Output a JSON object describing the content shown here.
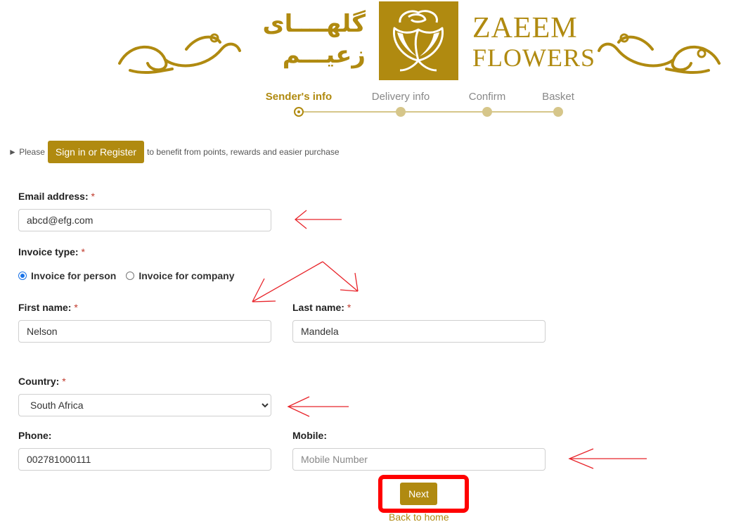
{
  "brand": {
    "name_line1": "ZAEEM",
    "name_line2": "FLOWERS",
    "arabic_line1": "گلهــــای",
    "arabic_line2": "زعیـــم",
    "color": "#b08a10"
  },
  "steps": [
    {
      "label": "Sender's info",
      "active": true
    },
    {
      "label": "Delivery info",
      "active": false
    },
    {
      "label": "Confirm",
      "active": false
    },
    {
      "label": "Basket",
      "active": false
    }
  ],
  "signin": {
    "prefix": "► Please",
    "button_label": "Sign in or Register",
    "suffix": "to benefit from points, rewards and easier purchase"
  },
  "form": {
    "email": {
      "label": "Email address:",
      "required_mark": "*",
      "value": "abcd@efg.com"
    },
    "invoice_type": {
      "label": "Invoice type:",
      "required_mark": "*",
      "options": [
        {
          "label": "Invoice for person",
          "checked": true
        },
        {
          "label": "Invoice for company",
          "checked": false
        }
      ]
    },
    "first_name": {
      "label": "First name:",
      "required_mark": "*",
      "value": "Nelson"
    },
    "last_name": {
      "label": "Last name:",
      "required_mark": "*",
      "value": "Mandela"
    },
    "country": {
      "label": "Country:",
      "required_mark": "*",
      "value": "South Africa"
    },
    "phone": {
      "label": "Phone:",
      "value": "002781000111"
    },
    "mobile": {
      "label": "Mobile:",
      "value": "",
      "placeholder": "Mobile Number"
    },
    "next_label": "Next",
    "back_label": "Back to home"
  },
  "annotation_color": "#e8242a",
  "highlight_color": "#ff0000"
}
